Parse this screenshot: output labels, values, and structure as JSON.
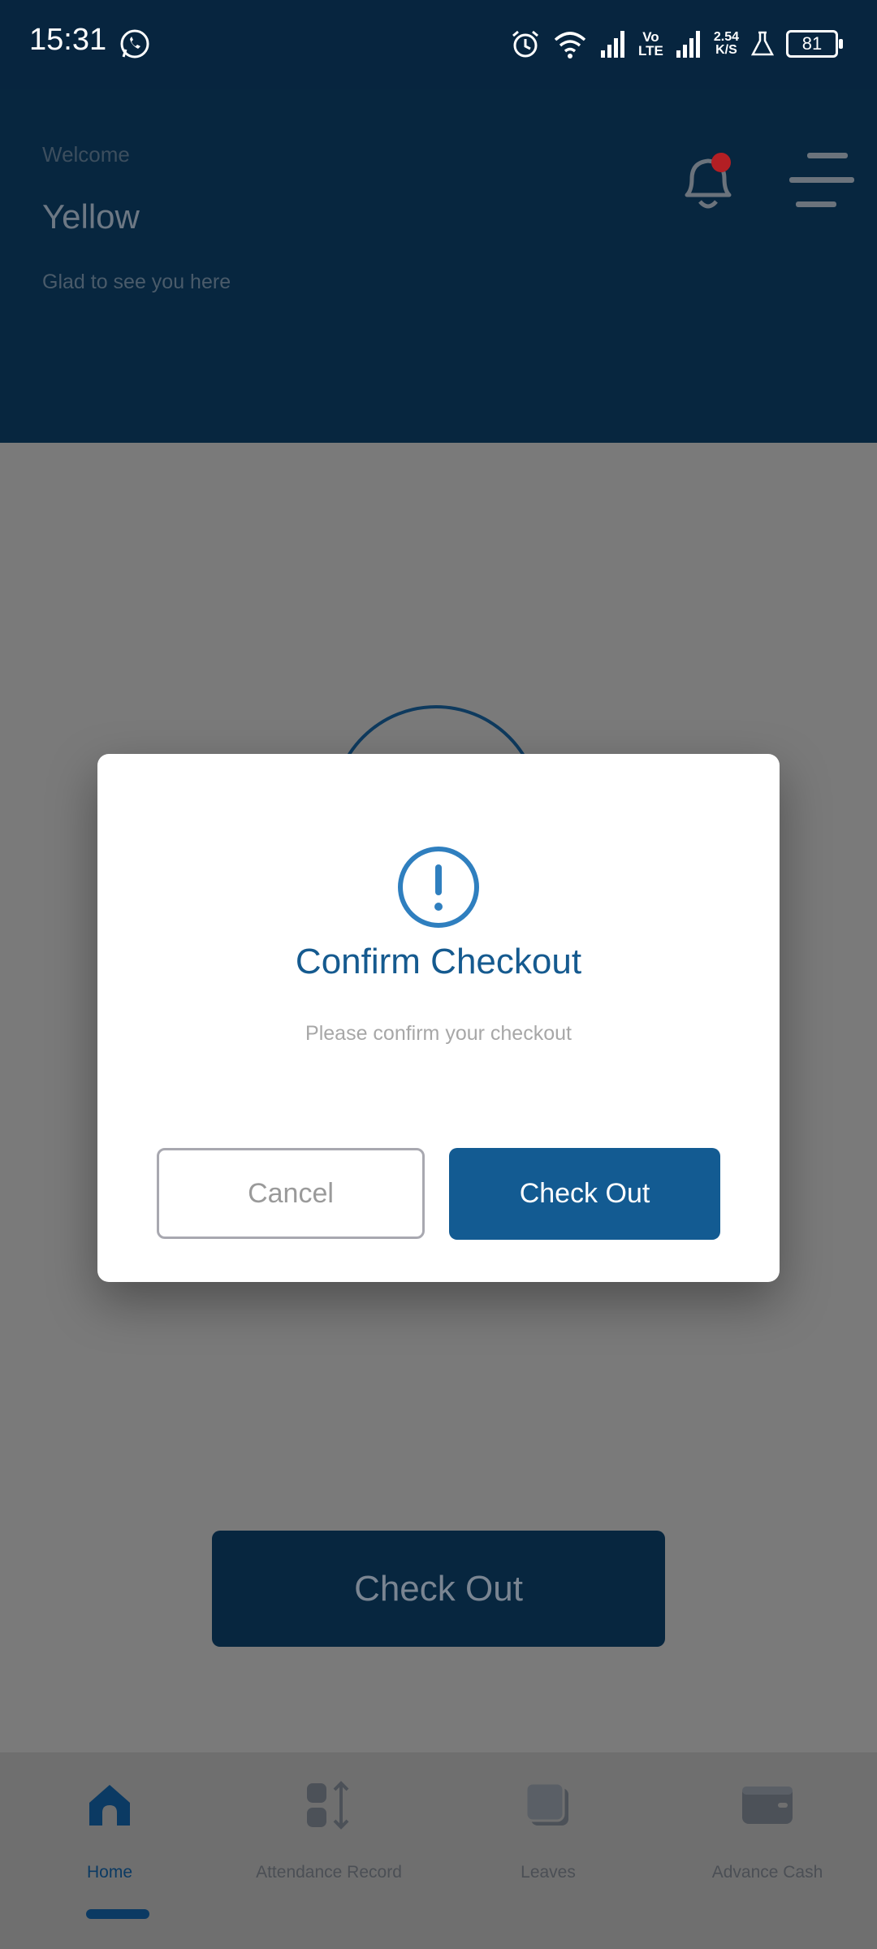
{
  "status_bar": {
    "time": "15:31",
    "net_speed_value": "2.54",
    "net_speed_unit": "K/S",
    "volte_top": "Vo",
    "volte_bottom": "LTE",
    "battery": "81"
  },
  "header": {
    "welcome": "Welcome",
    "username": "Yellow",
    "greeting": "Glad to see you here"
  },
  "main": {
    "checkout_button": "Check Out"
  },
  "dialog": {
    "title": "Confirm Checkout",
    "message": "Please confirm your checkout",
    "cancel_label": "Cancel",
    "confirm_label": "Check Out"
  },
  "bottom_nav": {
    "items": [
      {
        "label": "Home",
        "icon": "home-icon",
        "active": true
      },
      {
        "label": "Attendance Record",
        "icon": "attendance-icon",
        "active": false
      },
      {
        "label": "Leaves",
        "icon": "leaves-icon",
        "active": false
      },
      {
        "label": "Advance Cash",
        "icon": "wallet-icon",
        "active": false
      }
    ]
  },
  "colors": {
    "header_bg": "#07263f",
    "primary": "#135b92",
    "overlay_bg": "#7a7a7a"
  }
}
